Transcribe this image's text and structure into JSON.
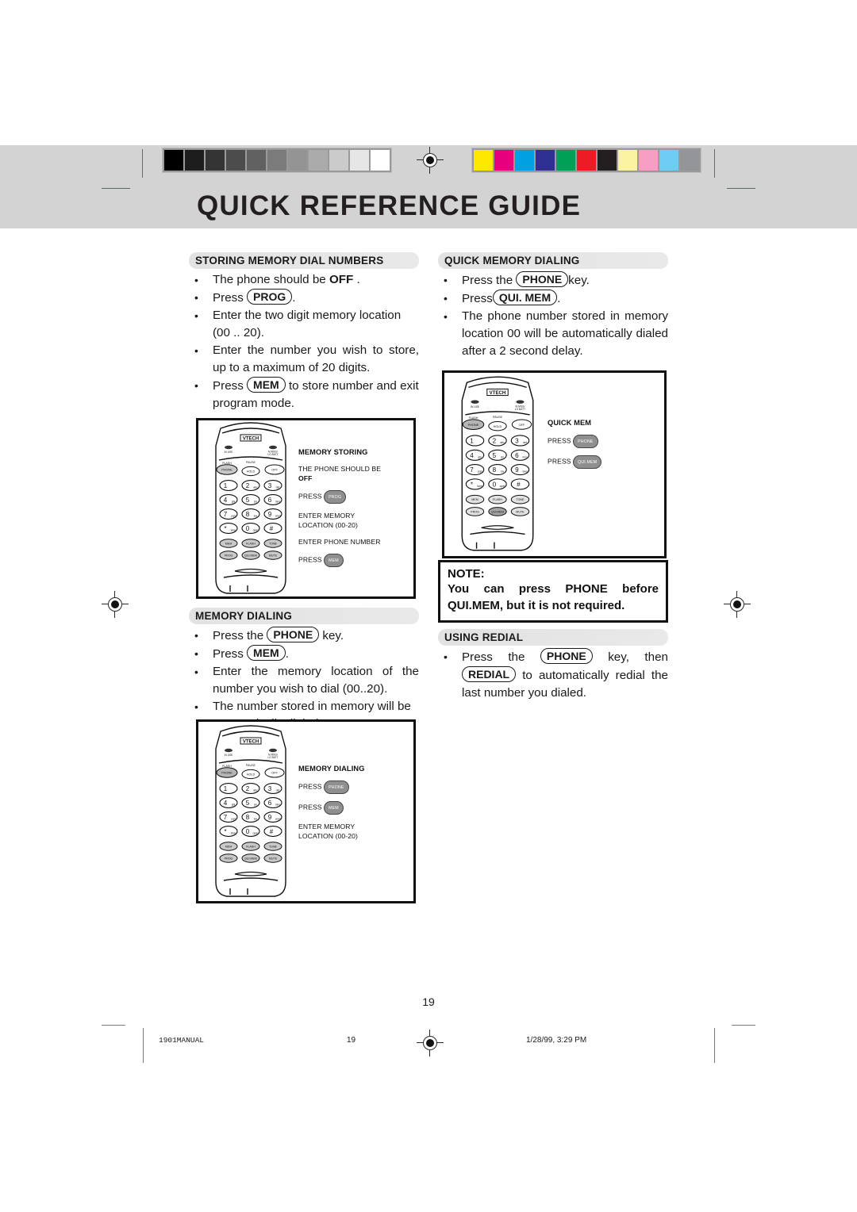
{
  "page": {
    "title": "QUICK REFERENCE GUIDE",
    "number": "19"
  },
  "prepress": {
    "gray_swatches": [
      "#000000",
      "#1d1d1d",
      "#343434",
      "#4c4c4c",
      "#616161",
      "#7b7b7b",
      "#949494",
      "#ababab",
      "#cbcbcb",
      "#e6e6e6",
      "#ffffff"
    ],
    "color_swatches": [
      "#ffe800",
      "#e6007e",
      "#00a0e3",
      "#2e3191",
      "#00a057",
      "#ed1c24",
      "#231f20",
      "#fcf3a0",
      "#f79ec4",
      "#6fcdf5",
      "#939598"
    ],
    "registration_mark": "registration-target"
  },
  "left_column": {
    "storing": {
      "heading": "STORING MEMORY DIAL NUMBERS",
      "items": [
        {
          "pre": "The phone should be ",
          "strong": "OFF",
          "post": " ."
        },
        {
          "pre": "Press ",
          "keycap": "PROG",
          "post": "."
        },
        {
          "pre": "Enter the two digit memory location (00 .. 20)."
        },
        {
          "pre": "Enter the number you wish to store, up to a maximum of 20 digits.",
          "justify": true
        },
        {
          "pre": "Press ",
          "keycap": "MEM",
          "post": " to store number and exit program mode."
        }
      ]
    },
    "dialing": {
      "heading": "MEMORY DIALING",
      "items": [
        {
          "pre": "Press the ",
          "keycap": "PHONE",
          "post": " key."
        },
        {
          "pre": "Press ",
          "keycap": "MEM",
          "post": "."
        },
        {
          "pre": "Enter the memory location of the number you wish to dial (00..20).",
          "justify": true
        },
        {
          "pre": "The number stored in memory will be automatically dialed."
        }
      ]
    }
  },
  "right_column": {
    "quick_memory": {
      "heading": "QUICK MEMORY DIALING",
      "items": [
        {
          "pre": "Press the ",
          "keycap": "PHONE",
          "post": "key."
        },
        {
          "pre": "Press",
          "keycap": "QUI. MEM",
          "post": "."
        },
        {
          "pre": "The phone number stored in memory location 00 will be automatically dialed after a 2 second delay.",
          "justify": true
        }
      ]
    },
    "note": {
      "title": "NOTE:",
      "body": "You can press PHONE before QUI.MEM, but it is not required."
    },
    "redial": {
      "heading": "USING REDIAL",
      "items": [
        {
          "pre": "Press the ",
          "keycap": "PHONE",
          "mid": " key, then ",
          "keycap2": "REDIAL",
          "post": " to automatically redial the last number you dialed.",
          "justify": true
        }
      ]
    }
  },
  "illustrations": {
    "memory_storing": {
      "title": "MEMORY STORING",
      "lines": [
        {
          "text": "THE PHONE SHOULD BE"
        },
        {
          "bold": "OFF"
        },
        {
          "text": "PRESS ",
          "button": "PROG"
        },
        {
          "text": "ENTER MEMORY"
        },
        {
          "text": "LOCATION (00-20)"
        },
        {
          "text": "ENTER PHONE NUMBER"
        },
        {
          "text": "PRESS ",
          "button": "MEM"
        }
      ]
    },
    "memory_dialing": {
      "title": "MEMORY DIALING",
      "lines": [
        {
          "text": "PRESS ",
          "button": "PHONE"
        },
        {
          "text": "PRESS ",
          "button": "MEM"
        },
        {
          "text": "ENTER MEMORY"
        },
        {
          "text": "LOCATION (00-20)"
        }
      ]
    },
    "quick_mem": {
      "title": "QUICK MEM",
      "lines": [
        {
          "text": "PRESS ",
          "button": "PHONE"
        },
        {
          "text": "PRESS ",
          "button": "QUI.MEM"
        }
      ]
    }
  },
  "phone": {
    "brand": "VTECH",
    "indicators": [
      {
        "label1": "IN USE"
      },
      {
        "label1": "M.MSG/",
        "label2": "LO BATT"
      }
    ],
    "top_labels": {
      "flash": "FLASH",
      "pause": "PAUSE"
    },
    "top_row": [
      "PHONE",
      "HOLD",
      "OFF"
    ],
    "keypad": [
      {
        "digit": "1",
        "letters": ""
      },
      {
        "digit": "2",
        "letters": "abc"
      },
      {
        "digit": "3",
        "letters": "def"
      },
      {
        "digit": "4",
        "letters": "ghi"
      },
      {
        "digit": "5",
        "letters": "jkl"
      },
      {
        "digit": "6",
        "letters": "mno"
      },
      {
        "digit": "7",
        "letters": "pqrs"
      },
      {
        "digit": "8",
        "letters": "tuv"
      },
      {
        "digit": "9",
        "letters": "wxyz"
      },
      {
        "digit": "*",
        "letters": "tone"
      },
      {
        "digit": "0",
        "letters": "oper"
      },
      {
        "digit": "#",
        "letters": ""
      }
    ],
    "function_rows": [
      [
        "MEM",
        "FLASH",
        "TONE"
      ],
      [
        "PROG",
        "QUI.MEM",
        "MUTE"
      ]
    ]
  },
  "footer": {
    "document": "1901MANUAL",
    "page": "19",
    "timestamp": "1/28/99, 3:29 PM"
  }
}
